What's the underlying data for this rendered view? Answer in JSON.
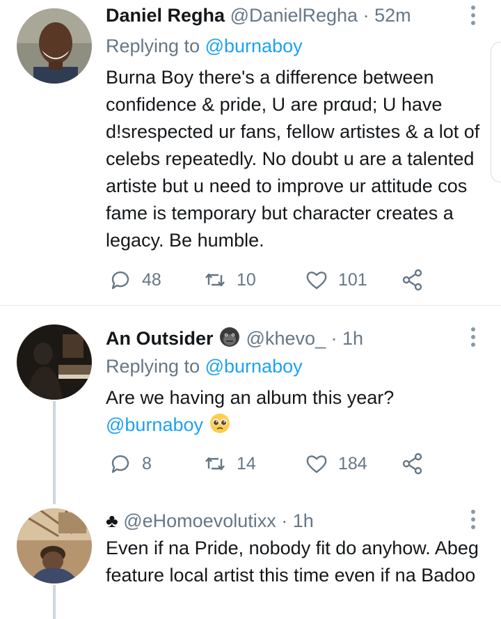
{
  "tweets": [
    {
      "name": "Daniel Regha",
      "handle": "@DanielRegha",
      "time": "· 52m",
      "reply_prefix": "Replying to",
      "reply_to": "@burnaboy",
      "text": "Burna Boy there's a difference between confidence & pride, U are prꭤud; U have d!srespected ur fans, fellow artistes & a lot of celebs repeatedly. No doubt u are a talented artiste but u need to improve ur attitude cos fame is temporary but character creates a legacy. Be humble.",
      "replies": "48",
      "retweets": "10",
      "likes": "101"
    },
    {
      "name": "An Outsider",
      "handle": "@khevo_",
      "time": "· 1h",
      "reply_prefix": "Replying to",
      "reply_to": "@burnaboy",
      "text": "Are we having an album this year?",
      "mention": "@burnaboy",
      "replies": "8",
      "retweets": "14",
      "likes": "184"
    },
    {
      "name_symbol": "♣",
      "handle": "@eHomoevolutixx",
      "time": "· 1h",
      "text": "Even if na Pride, nobody fit do anyhow. Abeg feature local artist this time even if na Badoo"
    }
  ],
  "colors": {
    "link": "#1da1f2",
    "muted": "#657786",
    "divider": "#e1e8ed",
    "thread_line": "#ccd6dd"
  }
}
